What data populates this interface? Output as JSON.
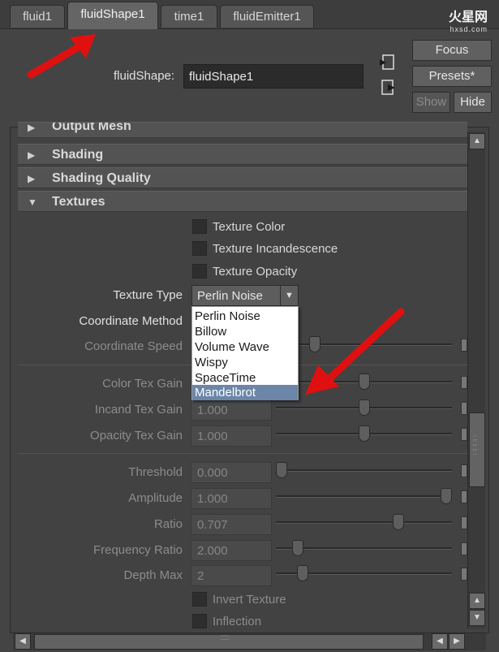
{
  "tabs": [
    {
      "label": "fluid1",
      "active": false
    },
    {
      "label": "fluidShape1",
      "active": true
    },
    {
      "label": "time1",
      "active": false
    },
    {
      "label": "fluidEmitter1",
      "active": false
    }
  ],
  "header": {
    "node_label": "fluidShape:",
    "node_value": "fluidShape1",
    "buttons": {
      "focus": "Focus",
      "presets": "Presets*",
      "show": "Show",
      "hide": "Hide"
    },
    "icons": [
      "input-connection-icon",
      "output-connection-icon"
    ]
  },
  "sections": {
    "output_mesh": "Output Mesh",
    "shading": "Shading",
    "shading_quality": "Shading Quality",
    "textures": "Textures"
  },
  "textures": {
    "checkboxes": {
      "texture_color": {
        "label": "Texture Color",
        "checked": false
      },
      "texture_incandescence": {
        "label": "Texture Incandescence",
        "checked": false
      },
      "texture_opacity": {
        "label": "Texture Opacity",
        "checked": false
      }
    },
    "texture_type": {
      "label": "Texture Type",
      "value": "Perlin Noise",
      "options": [
        "Perlin Noise",
        "Billow",
        "Volume Wave",
        "Wispy",
        "SpaceTime",
        "Mandelbrot"
      ],
      "highlighted": "Mandelbrot"
    },
    "coordinate_method_label": "Coordinate Method",
    "params": {
      "coordinate_speed": {
        "label": "Coordinate Speed",
        "value": "",
        "slider": 0.2
      },
      "color_tex_gain": {
        "label": "Color Tex Gain",
        "value": "",
        "slider": 0.5
      },
      "incand_tex_gain": {
        "label": "Incand Tex Gain",
        "value": "1.000",
        "slider": 0.5
      },
      "opacity_tex_gain": {
        "label": "Opacity Tex Gain",
        "value": "1.000",
        "slider": 0.5
      },
      "threshold": {
        "label": "Threshold",
        "value": "0.000",
        "slider": 0.0
      },
      "amplitude": {
        "label": "Amplitude",
        "value": "1.000",
        "slider": 1.0
      },
      "ratio": {
        "label": "Ratio",
        "value": "0.707",
        "slider": 0.707
      },
      "frequency_ratio": {
        "label": "Frequency Ratio",
        "value": "2.000",
        "slider": 0.1
      },
      "depth_max": {
        "label": "Depth Max",
        "value": "2",
        "slider": 0.13
      }
    },
    "invert_texture": {
      "label": "Invert Texture",
      "checked": false
    },
    "inflection": {
      "label": "Inflection",
      "checked": false
    }
  },
  "watermark": {
    "brand": "火星网",
    "url": "hxsd.com"
  },
  "annotation_color": "#e01010"
}
